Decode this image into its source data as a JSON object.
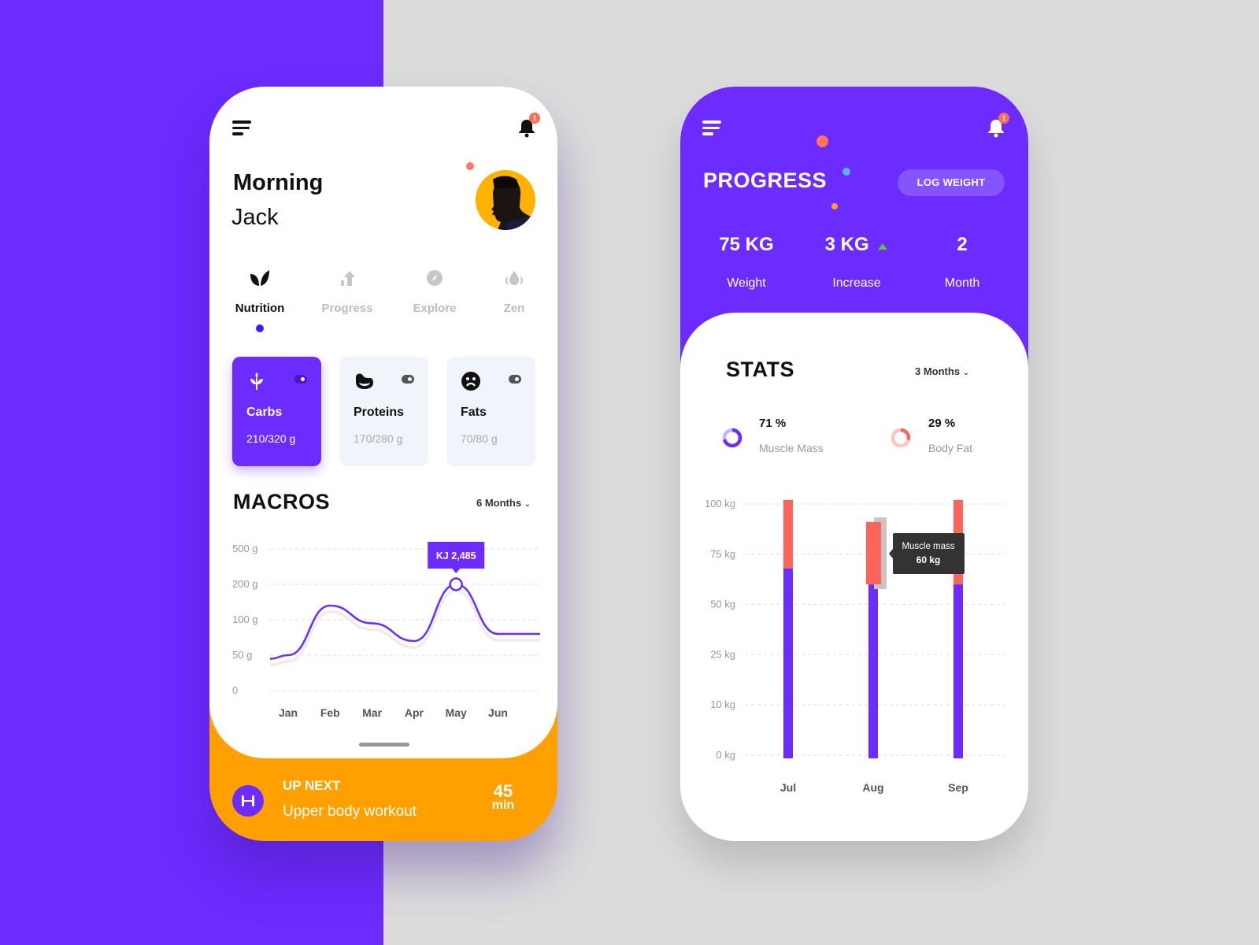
{
  "colors": {
    "purple": "#6c2bff",
    "orange": "#ff9f00",
    "coral": "#ff645c",
    "green": "#5cc22e",
    "blue": "#56b8f5"
  },
  "left": {
    "menu_icon": "menu-icon",
    "notification_count": "1",
    "greeting": "Morning",
    "user_name": "Jack",
    "tabs": [
      {
        "label": "Nutrition",
        "icon": "leaf-icon",
        "active": true
      },
      {
        "label": "Progress",
        "icon": "chart-arrow-icon",
        "active": false
      },
      {
        "label": "Explore",
        "icon": "compass-icon",
        "active": false
      },
      {
        "label": "Zen",
        "icon": "lotus-icon",
        "active": false
      }
    ],
    "macro_cards": [
      {
        "name": "Carbs",
        "value": "210/320 g",
        "icon": "wheat-icon",
        "active": true
      },
      {
        "name": "Proteins",
        "value": "170/280 g",
        "icon": "steak-icon",
        "active": false
      },
      {
        "name": "Fats",
        "value": "70/80 g",
        "icon": "sad-face-icon",
        "active": false
      }
    ],
    "macros": {
      "title": "MACROS",
      "period": "6 Months",
      "tooltip": "KJ 2,485"
    },
    "up_next": {
      "label": "UP NEXT",
      "workout": "Upper body workout",
      "duration": "45",
      "unit": "min"
    }
  },
  "right": {
    "notification_count": "1",
    "title": "PROGRESS",
    "log_button": "LOG WEIGHT",
    "stats_summary": [
      {
        "value": "75 KG",
        "label": "Weight"
      },
      {
        "value": "3 KG",
        "label": "Increase",
        "trend": "up"
      },
      {
        "value": "2",
        "label": "Month"
      }
    ],
    "stats": {
      "title": "STATS",
      "period": "3 Months",
      "muscle": {
        "value": "71 %",
        "label": "Muscle Mass",
        "fraction": 0.71
      },
      "fat": {
        "value": "29 %",
        "label": "Body Fat",
        "fraction": 0.29
      },
      "tooltip_title": "Muscle mass",
      "tooltip_value": "60 kg"
    }
  },
  "chart_data": [
    {
      "type": "line",
      "title": "MACROS",
      "categories": [
        "Jan",
        "Feb",
        "Mar",
        "Apr",
        "May",
        "Jun"
      ],
      "y_ticks": [
        "0",
        "50 g",
        "100 g",
        "200 g",
        "500 g"
      ],
      "values": [
        50,
        140,
        95,
        70,
        200,
        80
      ],
      "highlight": {
        "category": "May",
        "label": "KJ 2,485"
      },
      "grid": true
    },
    {
      "type": "bar",
      "title": "STATS",
      "categories": [
        "Jul",
        "Aug",
        "Sep"
      ],
      "y_ticks": [
        "0 kg",
        "10 kg",
        "25 kg",
        "50 kg",
        "75 kg",
        "100 kg"
      ],
      "series": [
        {
          "name": "Muscle mass",
          "values": [
            68,
            60,
            60
          ],
          "color": "#6c2bff"
        },
        {
          "name": "Body fat",
          "values": [
            34,
            31,
            42
          ],
          "color": "#ff645c"
        }
      ],
      "highlight": {
        "category": "Aug",
        "series": "Muscle mass",
        "label": "60 kg"
      },
      "grid": true
    }
  ]
}
